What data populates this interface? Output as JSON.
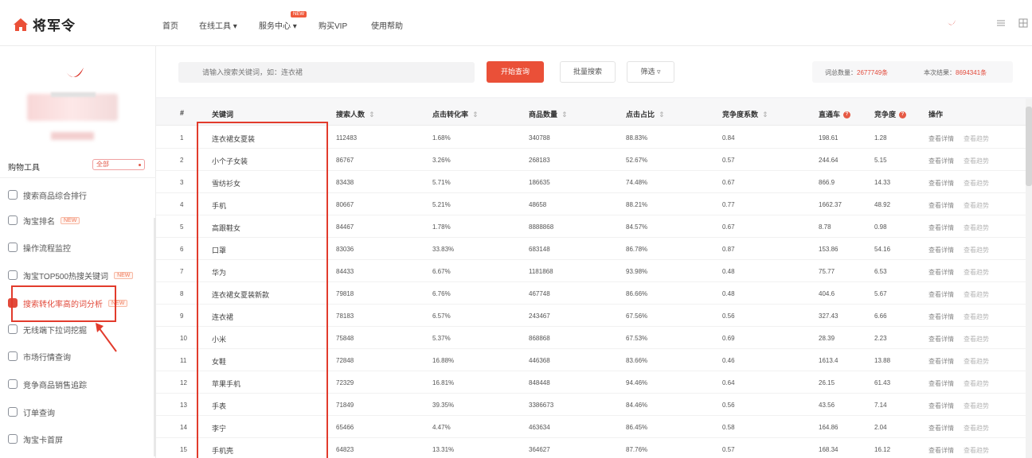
{
  "brand": {
    "name": "将军令",
    "accent": "#e24a3b"
  },
  "nav": {
    "items": [
      "首页",
      "在线工具 ▾",
      "服务中心 ▾",
      "购买VIP",
      "使用帮助"
    ],
    "badge": "NEW"
  },
  "sidebar": {
    "tools_title": "购物工具",
    "tools_select": "全部",
    "items": [
      {
        "label": "搜索商品综合排行",
        "tag": ""
      },
      {
        "label": "淘宝排名",
        "tag": "NEW"
      },
      {
        "label": "操作流程监控",
        "tag": ""
      },
      {
        "label": "淘宝TOP500热搜关键词",
        "tag": "NEW"
      },
      {
        "label": "搜索转化率高的词分析",
        "tag": "NEW"
      },
      {
        "label": "无线端下拉词挖掘",
        "tag": ""
      },
      {
        "label": "市场行情查询",
        "tag": ""
      },
      {
        "label": "竞争商品销售追踪",
        "tag": ""
      },
      {
        "label": "订单查询",
        "tag": ""
      },
      {
        "label": "淘宝卡首屏",
        "tag": ""
      }
    ]
  },
  "search": {
    "placeholder": "请输入搜索关键词，如：连衣裙",
    "primary_button": "开始查询",
    "export_button": "批量搜索",
    "filter_button": "筛选 ▿",
    "stats": [
      {
        "label": "词总数量：",
        "value": "2677749条"
      },
      {
        "label": "本次结果：",
        "value": "8694341条"
      }
    ]
  },
  "table": {
    "headers": [
      "#",
      "关键词",
      "搜索人数",
      "点击转化率",
      "商品数量",
      "点击占比",
      "竞争度系数",
      "直通车",
      "竞争度",
      "操作"
    ],
    "action_labels": [
      "查看详情",
      "查看趋势"
    ],
    "rows": [
      [
        "1",
        "连衣裙女夏装",
        "112483",
        "1.68%",
        "340788",
        "88.83%",
        "0.84",
        "198.61",
        "1.28"
      ],
      [
        "2",
        "小个子女装",
        "86767",
        "3.26%",
        "268183",
        "52.67%",
        "0.57",
        "244.64",
        "5.15"
      ],
      [
        "3",
        "雪纺衫女",
        "83438",
        "5.71%",
        "186635",
        "74.48%",
        "0.67",
        "866.9",
        "14.33"
      ],
      [
        "4",
        "手机",
        "80667",
        "5.21%",
        "48658",
        "88.21%",
        "0.77",
        "1662.37",
        "48.92"
      ],
      [
        "5",
        "高跟鞋女",
        "84467",
        "1.78%",
        "8888868",
        "84.57%",
        "0.67",
        "8.78",
        "0.98"
      ],
      [
        "6",
        "口罩",
        "83036",
        "33.83%",
        "683148",
        "86.78%",
        "0.87",
        "153.86",
        "54.16"
      ],
      [
        "7",
        "华为",
        "84433",
        "6.67%",
        "1181868",
        "93.98%",
        "0.48",
        "75.77",
        "6.53"
      ],
      [
        "8",
        "连衣裙女夏装新款",
        "79818",
        "6.76%",
        "467748",
        "86.66%",
        "0.48",
        "404.6",
        "5.67"
      ],
      [
        "9",
        "连衣裙",
        "78183",
        "6.57%",
        "243467",
        "67.56%",
        "0.56",
        "327.43",
        "6.66"
      ],
      [
        "10",
        "小米",
        "75848",
        "5.37%",
        "868868",
        "67.53%",
        "0.69",
        "28.39",
        "2.23"
      ],
      [
        "11",
        "女鞋",
        "72848",
        "16.88%",
        "446368",
        "83.66%",
        "0.46",
        "1613.4",
        "13.88"
      ],
      [
        "12",
        "苹果手机",
        "72329",
        "16.81%",
        "848448",
        "94.46%",
        "0.64",
        "26.15",
        "61.43"
      ],
      [
        "13",
        "手表",
        "71849",
        "39.35%",
        "3386673",
        "84.46%",
        "0.56",
        "43.56",
        "7.14"
      ],
      [
        "14",
        "李宁",
        "65466",
        "4.47%",
        "463634",
        "86.45%",
        "0.58",
        "164.86",
        "2.04"
      ],
      [
        "15",
        "手机壳",
        "64823",
        "13.31%",
        "364627",
        "87.76%",
        "0.57",
        "168.34",
        "16.12"
      ]
    ]
  }
}
